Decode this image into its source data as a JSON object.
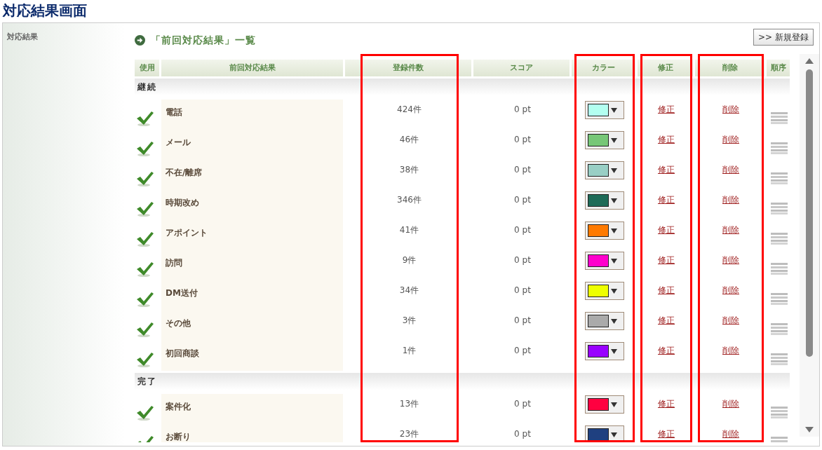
{
  "page_title": "対応結果画面",
  "sidebar": {
    "label": "対応結果"
  },
  "section": {
    "title": "「前回対応結果」一覧",
    "new_button": ">> 新規登録"
  },
  "table": {
    "columns": [
      {
        "label": "使用",
        "highlighted": false
      },
      {
        "label": "前回対応結果",
        "highlighted": false
      },
      {
        "label": "登録件数",
        "highlighted": true
      },
      {
        "label": "スコア",
        "highlighted": false
      },
      {
        "label": "カラー",
        "highlighted": true
      },
      {
        "label": "修正",
        "highlighted": true
      },
      {
        "label": "削除",
        "highlighted": true
      },
      {
        "label": "順序",
        "highlighted": false
      }
    ],
    "groups": [
      {
        "label": "継続",
        "rows": [
          {
            "used": true,
            "name": "電話",
            "count": "424件",
            "score": "0 pt",
            "color": "#b3fff0",
            "edit": "修正",
            "delete": "削除"
          },
          {
            "used": true,
            "name": "メール",
            "count": "46件",
            "score": "0 pt",
            "color": "#77c777",
            "edit": "修正",
            "delete": "削除"
          },
          {
            "used": true,
            "name": "不在/離席",
            "count": "38件",
            "score": "0 pt",
            "color": "#99cfc5",
            "edit": "修正",
            "delete": "削除"
          },
          {
            "used": true,
            "name": "時期改め",
            "count": "346件",
            "score": "0 pt",
            "color": "#1f6b57",
            "edit": "修正",
            "delete": "削除"
          },
          {
            "used": true,
            "name": "アポイント",
            "count": "41件",
            "score": "0 pt",
            "color": "#ff7a00",
            "edit": "修正",
            "delete": "削除"
          },
          {
            "used": true,
            "name": "訪問",
            "count": "9件",
            "score": "0 pt",
            "color": "#ff00cc",
            "edit": "修正",
            "delete": "削除"
          },
          {
            "used": true,
            "name": "DM送付",
            "count": "34件",
            "score": "0 pt",
            "color": "#eeff00",
            "edit": "修正",
            "delete": "削除"
          },
          {
            "used": true,
            "name": "その他",
            "count": "3件",
            "score": "0 pt",
            "color": "#aaaaaa",
            "edit": "修正",
            "delete": "削除"
          },
          {
            "used": true,
            "name": "初回商談",
            "count": "1件",
            "score": "0 pt",
            "color": "#9900ff",
            "edit": "修正",
            "delete": "削除"
          }
        ]
      },
      {
        "label": "完了",
        "rows": [
          {
            "used": true,
            "name": "案件化",
            "count": "13件",
            "score": "0 pt",
            "color": "#ff0040",
            "edit": "修正",
            "delete": "削除"
          },
          {
            "used": true,
            "name": "お断り",
            "count": "23件",
            "score": "0 pt",
            "color": "#1f4080",
            "edit": "修正",
            "delete": "削除"
          }
        ]
      }
    ]
  }
}
